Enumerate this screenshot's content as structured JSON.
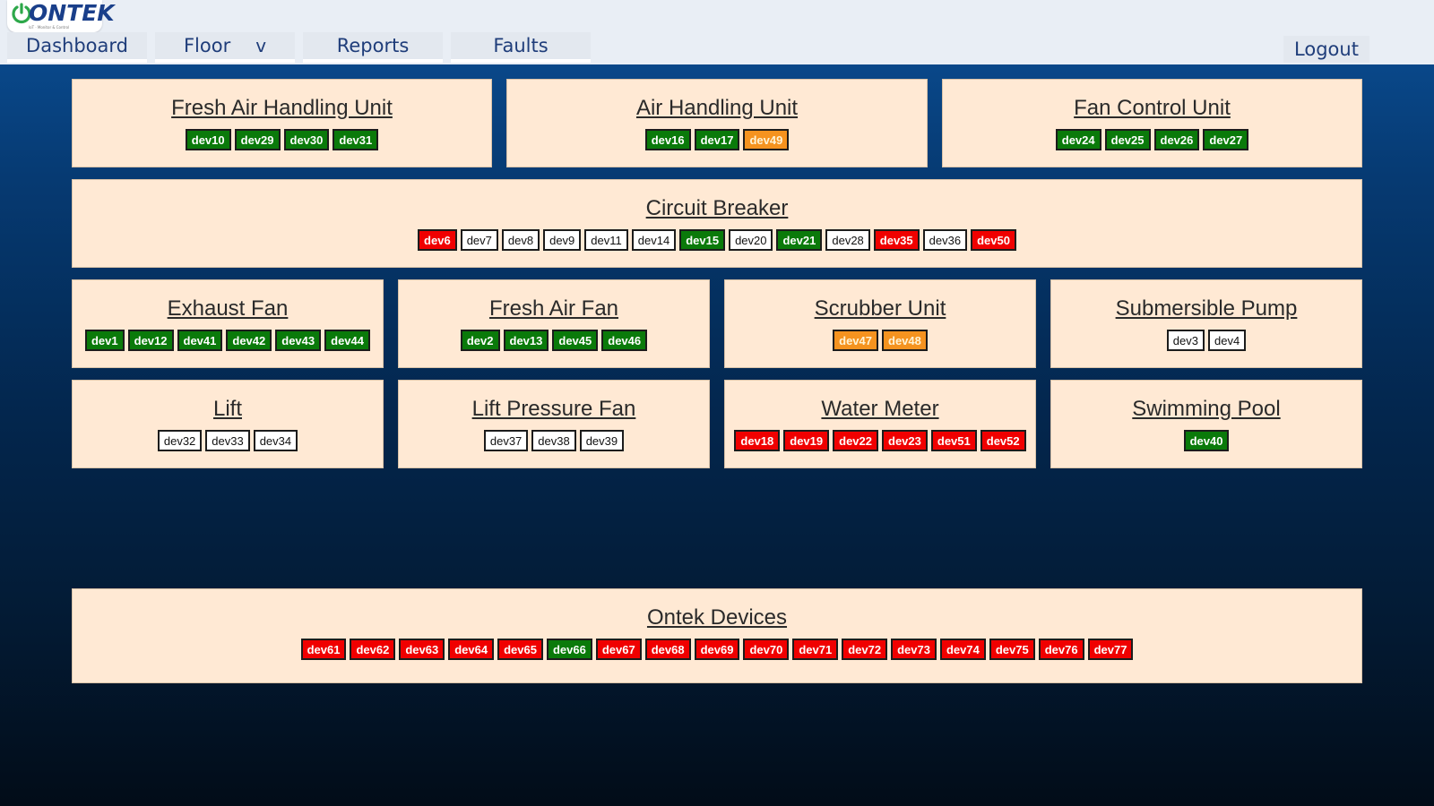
{
  "header": {
    "logo_text": "ONTEK",
    "logo_tagline": "IoT · Monitor & Control",
    "nav": [
      {
        "label": "Dashboard"
      },
      {
        "label": "Floor",
        "chevron": "v"
      },
      {
        "label": "Reports"
      },
      {
        "label": "Faults"
      }
    ],
    "logout": "Logout"
  },
  "colors": {
    "green": "#0a7a0a",
    "orange": "#f5931f",
    "red": "#f00000",
    "white": "#ffffff",
    "card_bg": "#ffe9d4",
    "header_bg": "#e9eef5",
    "nav_text": "#1f3d7a"
  },
  "cards": [
    {
      "title": "Fresh Air Handling Unit",
      "devices": [
        {
          "id": "dev10",
          "status": "green"
        },
        {
          "id": "dev29",
          "status": "green"
        },
        {
          "id": "dev30",
          "status": "green"
        },
        {
          "id": "dev31",
          "status": "green"
        }
      ]
    },
    {
      "title": "Air Handling Unit",
      "devices": [
        {
          "id": "dev16",
          "status": "green"
        },
        {
          "id": "dev17",
          "status": "green"
        },
        {
          "id": "dev49",
          "status": "orange"
        }
      ]
    },
    {
      "title": "Fan Control Unit",
      "devices": [
        {
          "id": "dev24",
          "status": "green"
        },
        {
          "id": "dev25",
          "status": "green"
        },
        {
          "id": "dev26",
          "status": "green"
        },
        {
          "id": "dev27",
          "status": "green"
        }
      ]
    },
    {
      "title": "Circuit Breaker",
      "devices": [
        {
          "id": "dev6",
          "status": "red"
        },
        {
          "id": "dev7",
          "status": "white"
        },
        {
          "id": "dev8",
          "status": "white"
        },
        {
          "id": "dev9",
          "status": "white"
        },
        {
          "id": "dev11",
          "status": "white"
        },
        {
          "id": "dev14",
          "status": "white"
        },
        {
          "id": "dev15",
          "status": "green"
        },
        {
          "id": "dev20",
          "status": "white"
        },
        {
          "id": "dev21",
          "status": "green"
        },
        {
          "id": "dev28",
          "status": "white"
        },
        {
          "id": "dev35",
          "status": "red"
        },
        {
          "id": "dev36",
          "status": "white"
        },
        {
          "id": "dev50",
          "status": "red"
        }
      ]
    },
    {
      "title": "Exhaust Fan",
      "devices": [
        {
          "id": "dev1",
          "status": "green"
        },
        {
          "id": "dev12",
          "status": "green"
        },
        {
          "id": "dev41",
          "status": "green"
        },
        {
          "id": "dev42",
          "status": "green"
        },
        {
          "id": "dev43",
          "status": "green"
        },
        {
          "id": "dev44",
          "status": "green"
        }
      ]
    },
    {
      "title": "Fresh Air Fan",
      "devices": [
        {
          "id": "dev2",
          "status": "green"
        },
        {
          "id": "dev13",
          "status": "green"
        },
        {
          "id": "dev45",
          "status": "green"
        },
        {
          "id": "dev46",
          "status": "green"
        }
      ]
    },
    {
      "title": "Scrubber Unit",
      "devices": [
        {
          "id": "dev47",
          "status": "orange"
        },
        {
          "id": "dev48",
          "status": "orange"
        }
      ]
    },
    {
      "title": "Submersible Pump",
      "devices": [
        {
          "id": "dev3",
          "status": "white"
        },
        {
          "id": "dev4",
          "status": "white"
        }
      ]
    },
    {
      "title": "Lift",
      "devices": [
        {
          "id": "dev32",
          "status": "white"
        },
        {
          "id": "dev33",
          "status": "white"
        },
        {
          "id": "dev34",
          "status": "white"
        }
      ]
    },
    {
      "title": "Lift Pressure Fan",
      "devices": [
        {
          "id": "dev37",
          "status": "white"
        },
        {
          "id": "dev38",
          "status": "white"
        },
        {
          "id": "dev39",
          "status": "white"
        }
      ]
    },
    {
      "title": "Water Meter",
      "devices": [
        {
          "id": "dev18",
          "status": "red"
        },
        {
          "id": "dev19",
          "status": "red"
        },
        {
          "id": "dev22",
          "status": "red"
        },
        {
          "id": "dev23",
          "status": "red"
        },
        {
          "id": "dev51",
          "status": "red"
        },
        {
          "id": "dev52",
          "status": "red"
        }
      ]
    },
    {
      "title": "Swimming Pool",
      "devices": [
        {
          "id": "dev40",
          "status": "green"
        }
      ]
    },
    {
      "title": "Ontek Devices",
      "devices": [
        {
          "id": "dev61",
          "status": "red"
        },
        {
          "id": "dev62",
          "status": "red"
        },
        {
          "id": "dev63",
          "status": "red"
        },
        {
          "id": "dev64",
          "status": "red"
        },
        {
          "id": "dev65",
          "status": "red"
        },
        {
          "id": "dev66",
          "status": "green"
        },
        {
          "id": "dev67",
          "status": "red"
        },
        {
          "id": "dev68",
          "status": "red"
        },
        {
          "id": "dev69",
          "status": "red"
        },
        {
          "id": "dev70",
          "status": "red"
        },
        {
          "id": "dev71",
          "status": "red"
        },
        {
          "id": "dev72",
          "status": "red"
        },
        {
          "id": "dev73",
          "status": "red"
        },
        {
          "id": "dev74",
          "status": "red"
        },
        {
          "id": "dev75",
          "status": "red"
        },
        {
          "id": "dev76",
          "status": "red"
        },
        {
          "id": "dev77",
          "status": "red"
        }
      ]
    }
  ]
}
